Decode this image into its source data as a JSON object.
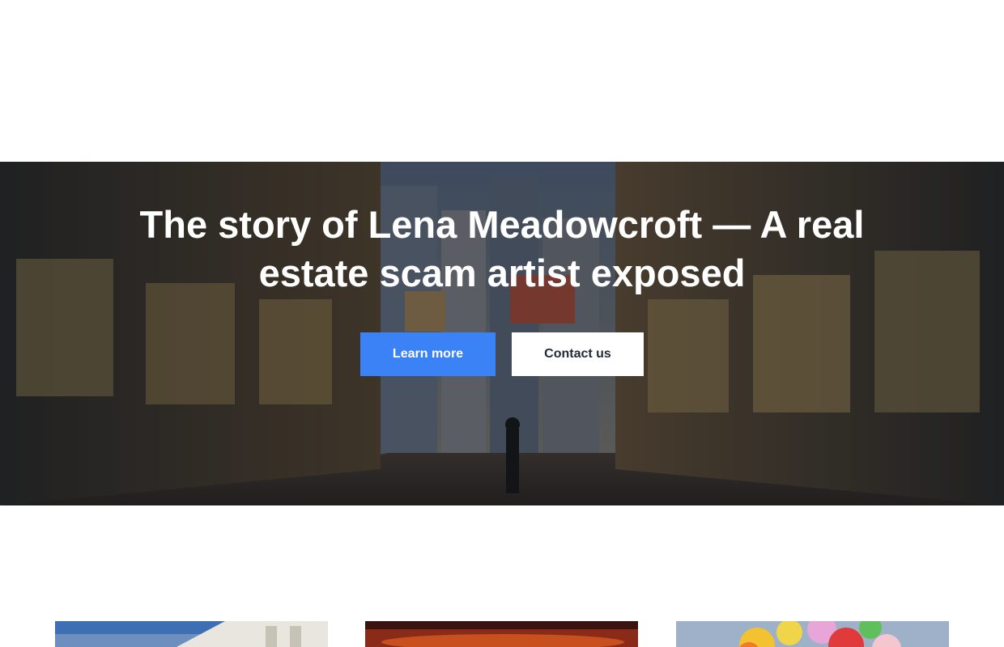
{
  "hero": {
    "title": "The story of Lena Meadowcroft — A real estate scam artist exposed",
    "primary_button": "Learn more",
    "secondary_button": "Contact us",
    "background_image": "night-city-alley-photo"
  },
  "cards": [
    {
      "image": "building-sky-photo"
    },
    {
      "image": "red-fire-sky-photo"
    },
    {
      "image": "colorful-balloons-photo"
    }
  ],
  "colors": {
    "primary_button": "#3b82f6",
    "secondary_button": "#ffffff",
    "title_text": "#ffffff"
  }
}
